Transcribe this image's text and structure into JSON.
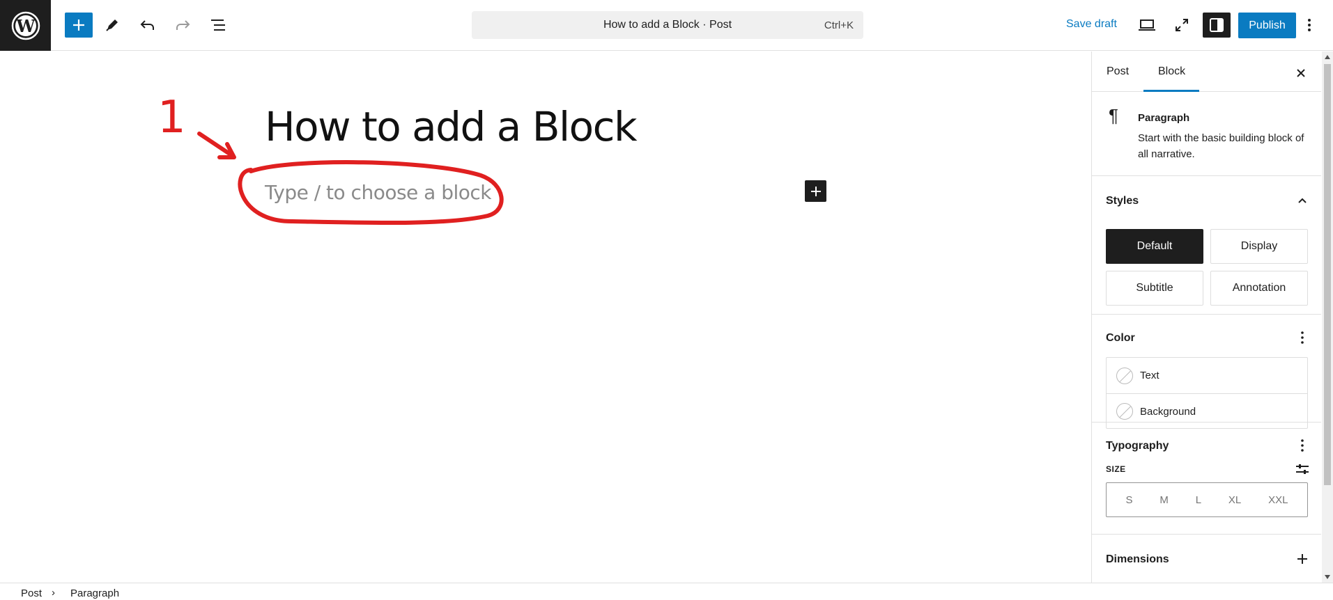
{
  "toolbar": {
    "document_title": "How to add a Block · Post",
    "shortcut": "Ctrl+K",
    "save_draft": "Save draft",
    "publish": "Publish"
  },
  "editor": {
    "post_title": "How to add a Block",
    "block_placeholder": "Type / to choose a block",
    "annotation_number": "1"
  },
  "sidebar": {
    "tabs": [
      {
        "label": "Post"
      },
      {
        "label": "Block"
      }
    ],
    "active_tab": "Block",
    "block_card": {
      "name": "Paragraph",
      "description": "Start with the basic building block of all narrative."
    },
    "styles": {
      "heading": "Styles",
      "options": [
        {
          "label": "Default"
        },
        {
          "label": "Display"
        },
        {
          "label": "Subtitle"
        },
        {
          "label": "Annotation"
        }
      ],
      "selected": "Default"
    },
    "color": {
      "heading": "Color",
      "items": [
        {
          "label": "Text"
        },
        {
          "label": "Background"
        }
      ]
    },
    "typography": {
      "heading": "Typography",
      "size_label": "SIZE",
      "sizes": [
        "S",
        "M",
        "L",
        "XL",
        "XXL"
      ]
    },
    "dimensions": {
      "heading": "Dimensions"
    }
  },
  "breadcrumb": {
    "items": [
      "Post",
      "Paragraph"
    ]
  },
  "colors": {
    "accent": "#0a7bc1",
    "dark": "#1e1e1e",
    "annotation": "#e02020"
  }
}
